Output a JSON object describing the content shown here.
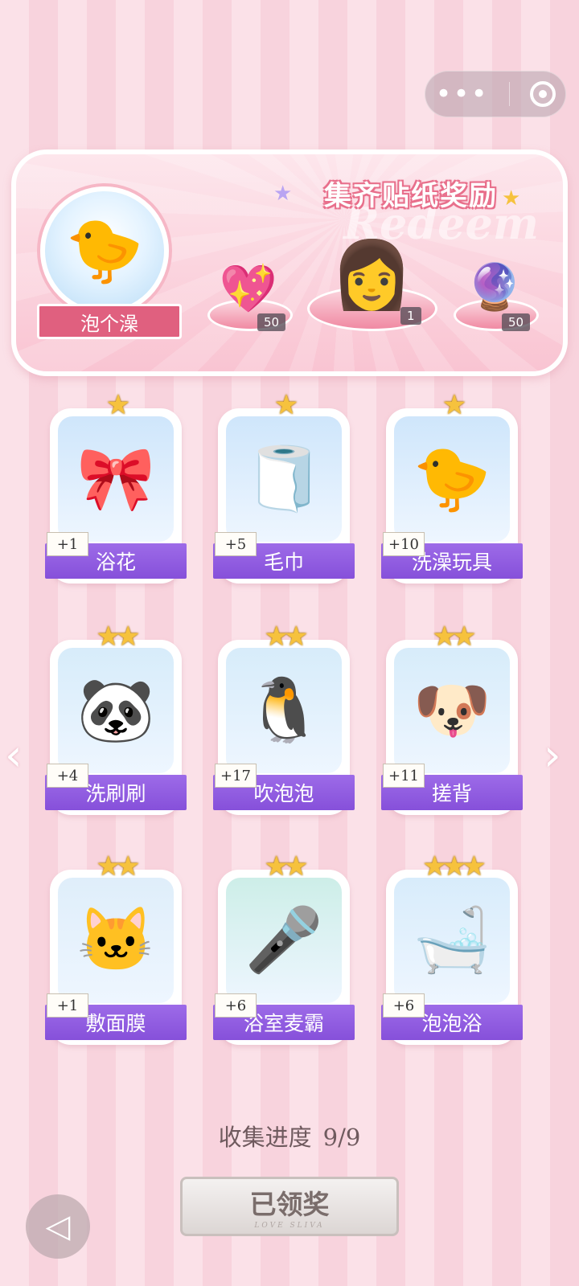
{
  "menu": {
    "more_icon": "more-dots-icon",
    "close_icon": "target-circle-icon"
  },
  "banner": {
    "title": "集齐贴纸奖励",
    "watermark": "Redeem",
    "theme_label": "泡个澡",
    "rewards": [
      {
        "name": "heart-gem",
        "icon": "💎",
        "qty": "50"
      },
      {
        "name": "avatar-portrait",
        "icon": "👩",
        "qty": "1"
      },
      {
        "name": "energy-orb",
        "icon": "🔮",
        "qty": "50"
      }
    ]
  },
  "cards": [
    {
      "label": "浴花",
      "plus": "+1",
      "stars": "★",
      "icon": "🎀",
      "bg": "#cfe6fb"
    },
    {
      "label": "毛巾",
      "plus": "+5",
      "stars": "★",
      "icon": "🧻",
      "bg": "#cfe6fb"
    },
    {
      "label": "洗澡玩具",
      "plus": "+10",
      "stars": "★",
      "icon": "🐤",
      "bg": "#cfe6fb"
    },
    {
      "label": "洗刷刷",
      "plus": "+4",
      "stars": "★★",
      "icon": "🐼",
      "bg": "#d7ecfa"
    },
    {
      "label": "吹泡泡",
      "plus": "+17",
      "stars": "★★",
      "icon": "🐧",
      "bg": "#d7ecfa"
    },
    {
      "label": "搓背",
      "plus": "+11",
      "stars": "★★",
      "icon": "🐶",
      "bg": "#d7ecfa"
    },
    {
      "label": "敷面膜",
      "plus": "+1",
      "stars": "★★",
      "icon": "🐱",
      "bg": "#dfeefa"
    },
    {
      "label": "浴室麦霸",
      "plus": "+6",
      "stars": "★★",
      "icon": "🎤",
      "bg": "#cdeee8"
    },
    {
      "label": "泡泡浴",
      "plus": "+6",
      "stars": "★★★",
      "icon": "🛁",
      "bg": "#d8ecfb"
    }
  ],
  "progress": {
    "label": "收集进度",
    "value": "9/9"
  },
  "claim_button": {
    "label": "已领奖",
    "sub": "LOVE SLIVA"
  },
  "nav": {
    "prev": "‹",
    "next": "›"
  }
}
